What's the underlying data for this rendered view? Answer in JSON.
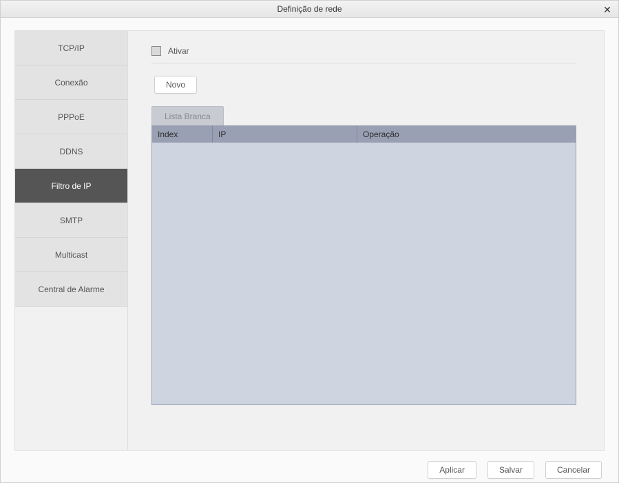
{
  "window": {
    "title": "Definição de rede"
  },
  "sidebar": {
    "items": [
      {
        "label": "TCP/IP"
      },
      {
        "label": "Conexão"
      },
      {
        "label": "PPPoE"
      },
      {
        "label": "DDNS"
      },
      {
        "label": "Filtro de IP"
      },
      {
        "label": "SMTP"
      },
      {
        "label": "Multicast"
      },
      {
        "label": "Central de Alarme"
      }
    ],
    "active_index": 4
  },
  "main": {
    "activate_label": "Ativar",
    "activate_checked": false,
    "new_button": "Novo",
    "tab_label": "Lista Branca",
    "columns": {
      "index": "Index",
      "ip": "IP",
      "op": "Operação"
    },
    "rows": []
  },
  "footer": {
    "apply": "Aplicar",
    "save": "Salvar",
    "cancel": "Cancelar"
  }
}
